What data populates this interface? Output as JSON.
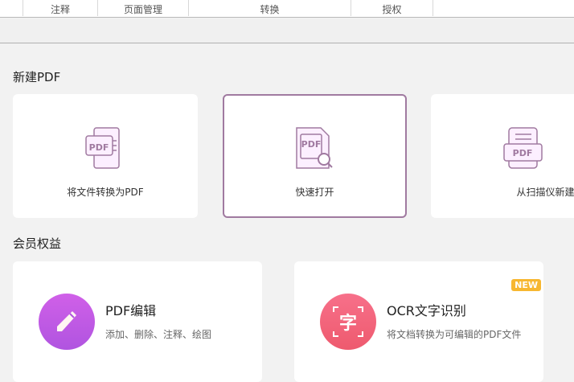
{
  "ribbon": {
    "groups": [
      "注释",
      "页面管理",
      "转换",
      "授权"
    ]
  },
  "new_pdf": {
    "heading": "新建PDF",
    "cards": [
      {
        "label": "将文件转换为PDF",
        "icon": "pdf-convert-icon"
      },
      {
        "label": "快速打开",
        "icon": "pdf-search-icon",
        "selected": true
      },
      {
        "label": "从扫描仪新建",
        "icon": "pdf-scanner-icon"
      }
    ]
  },
  "member": {
    "heading": "会员权益",
    "cards": [
      {
        "title": "PDF编辑",
        "subtitle": "添加、删除、注释、绘图",
        "icon": "pencil-icon",
        "color": "#c85ae0"
      },
      {
        "title": "OCR文字识别",
        "subtitle": "将文档转换为可编辑的PDF文件",
        "icon": "ocr-char-icon",
        "glyph": "字",
        "badge": "NEW",
        "color": "#f06478"
      }
    ]
  },
  "colors": {
    "accent": "#a07aa0",
    "icon_fill": "#fcefff",
    "badge": "#f7b731"
  }
}
